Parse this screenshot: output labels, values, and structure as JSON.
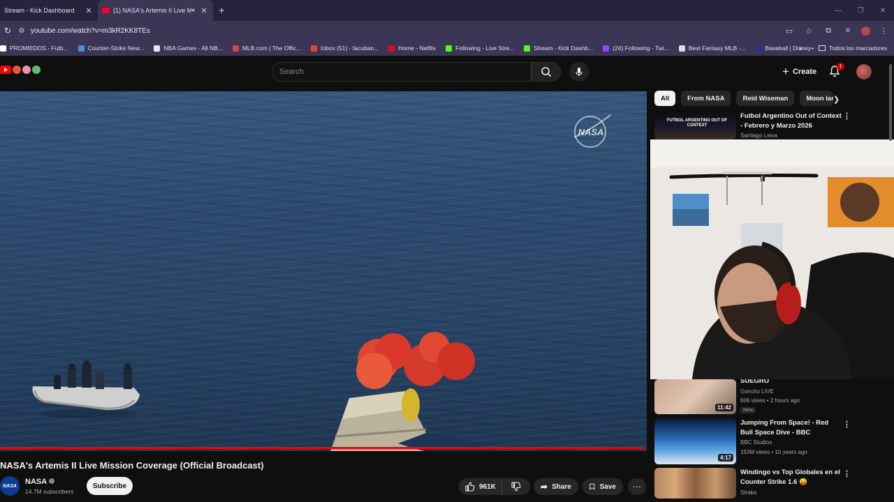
{
  "browser": {
    "tabs": [
      {
        "title": "Stream - Kick Dashboard",
        "active": false
      },
      {
        "title": "(1) NASA's Artemis II Live M",
        "active": true,
        "audible": true
      }
    ],
    "new_tab_icon": "+",
    "address": "youtube.com/watch?v=m3kR2KK8TEs",
    "bookmarks": [
      {
        "label": "PROMIEDOS - Futb...",
        "color": "#ffffff"
      },
      {
        "label": "Counter-Strike New...",
        "color": "#4a90d9"
      },
      {
        "label": "NBA Games - All NB...",
        "color": "#e8e8e8"
      },
      {
        "label": "MLB.com | The Offic...",
        "color": "#d64545"
      },
      {
        "label": "Inbox (51) - facuban...",
        "color": "#ea4335"
      },
      {
        "label": "Home - Netflix",
        "color": "#e50914"
      },
      {
        "label": "Following - Live Stre...",
        "color": "#53fc18"
      },
      {
        "label": "Stream - Kick Dashb...",
        "color": "#53fc18"
      },
      {
        "label": "(24) Following - Twi...",
        "color": "#9146ff"
      },
      {
        "label": "Best Fantasy MLB -...",
        "color": "#dddddd"
      },
      {
        "label": "Baseball | Disney+",
        "color": "#1f3a8a"
      }
    ],
    "all_bookmarks_label": "Todos los marcadores"
  },
  "header": {
    "search_placeholder": "Search",
    "create_label": "Create",
    "notifications_count": "1"
  },
  "video": {
    "watermark": "NASA",
    "title": "NASA's Artemis II Live Mission Coverage (Official Broadcast)",
    "progress_fraction": 0.995,
    "channel": {
      "name": "NASA",
      "avatar_text": "NASA",
      "subscribers": "14.7M subscribers"
    },
    "subscribe_label": "Subscribe",
    "likes": "961K",
    "share_label": "Share",
    "save_label": "Save"
  },
  "sidebar": {
    "chips": [
      "All",
      "From NASA",
      "Reid Wiseman",
      "Moon lan"
    ],
    "recommendations": [
      {
        "title": "Futbol Argentino Out of Context - Febrero y Marzo 2026",
        "channel": "Santiago Leiva",
        "meta": "",
        "duration": "",
        "thumb_text": "FUTBOL ARGENTINO OUT OF CONTEXT"
      },
      {
        "title": "SUEGRO",
        "channel": "Goncho LIVE",
        "meta": "606 views • 2 hours ago",
        "duration": "11:42",
        "badge": "New"
      },
      {
        "title": "Jumping From Space! - Red Bull Space Dive - BBC",
        "channel": "BBC Studios",
        "meta": "153M views • 10 years ago",
        "duration": "4:17"
      },
      {
        "title": "Windingo vs Top Globales en el Counter Strike 1.6 😛",
        "channel": "Straka",
        "meta": "",
        "duration": ""
      }
    ]
  },
  "colors": {
    "youtube_red": "#ff0000",
    "chrome_bg": "#28233d",
    "toolbar_bg": "#3b3556",
    "page_bg": "#0f0f0f"
  }
}
